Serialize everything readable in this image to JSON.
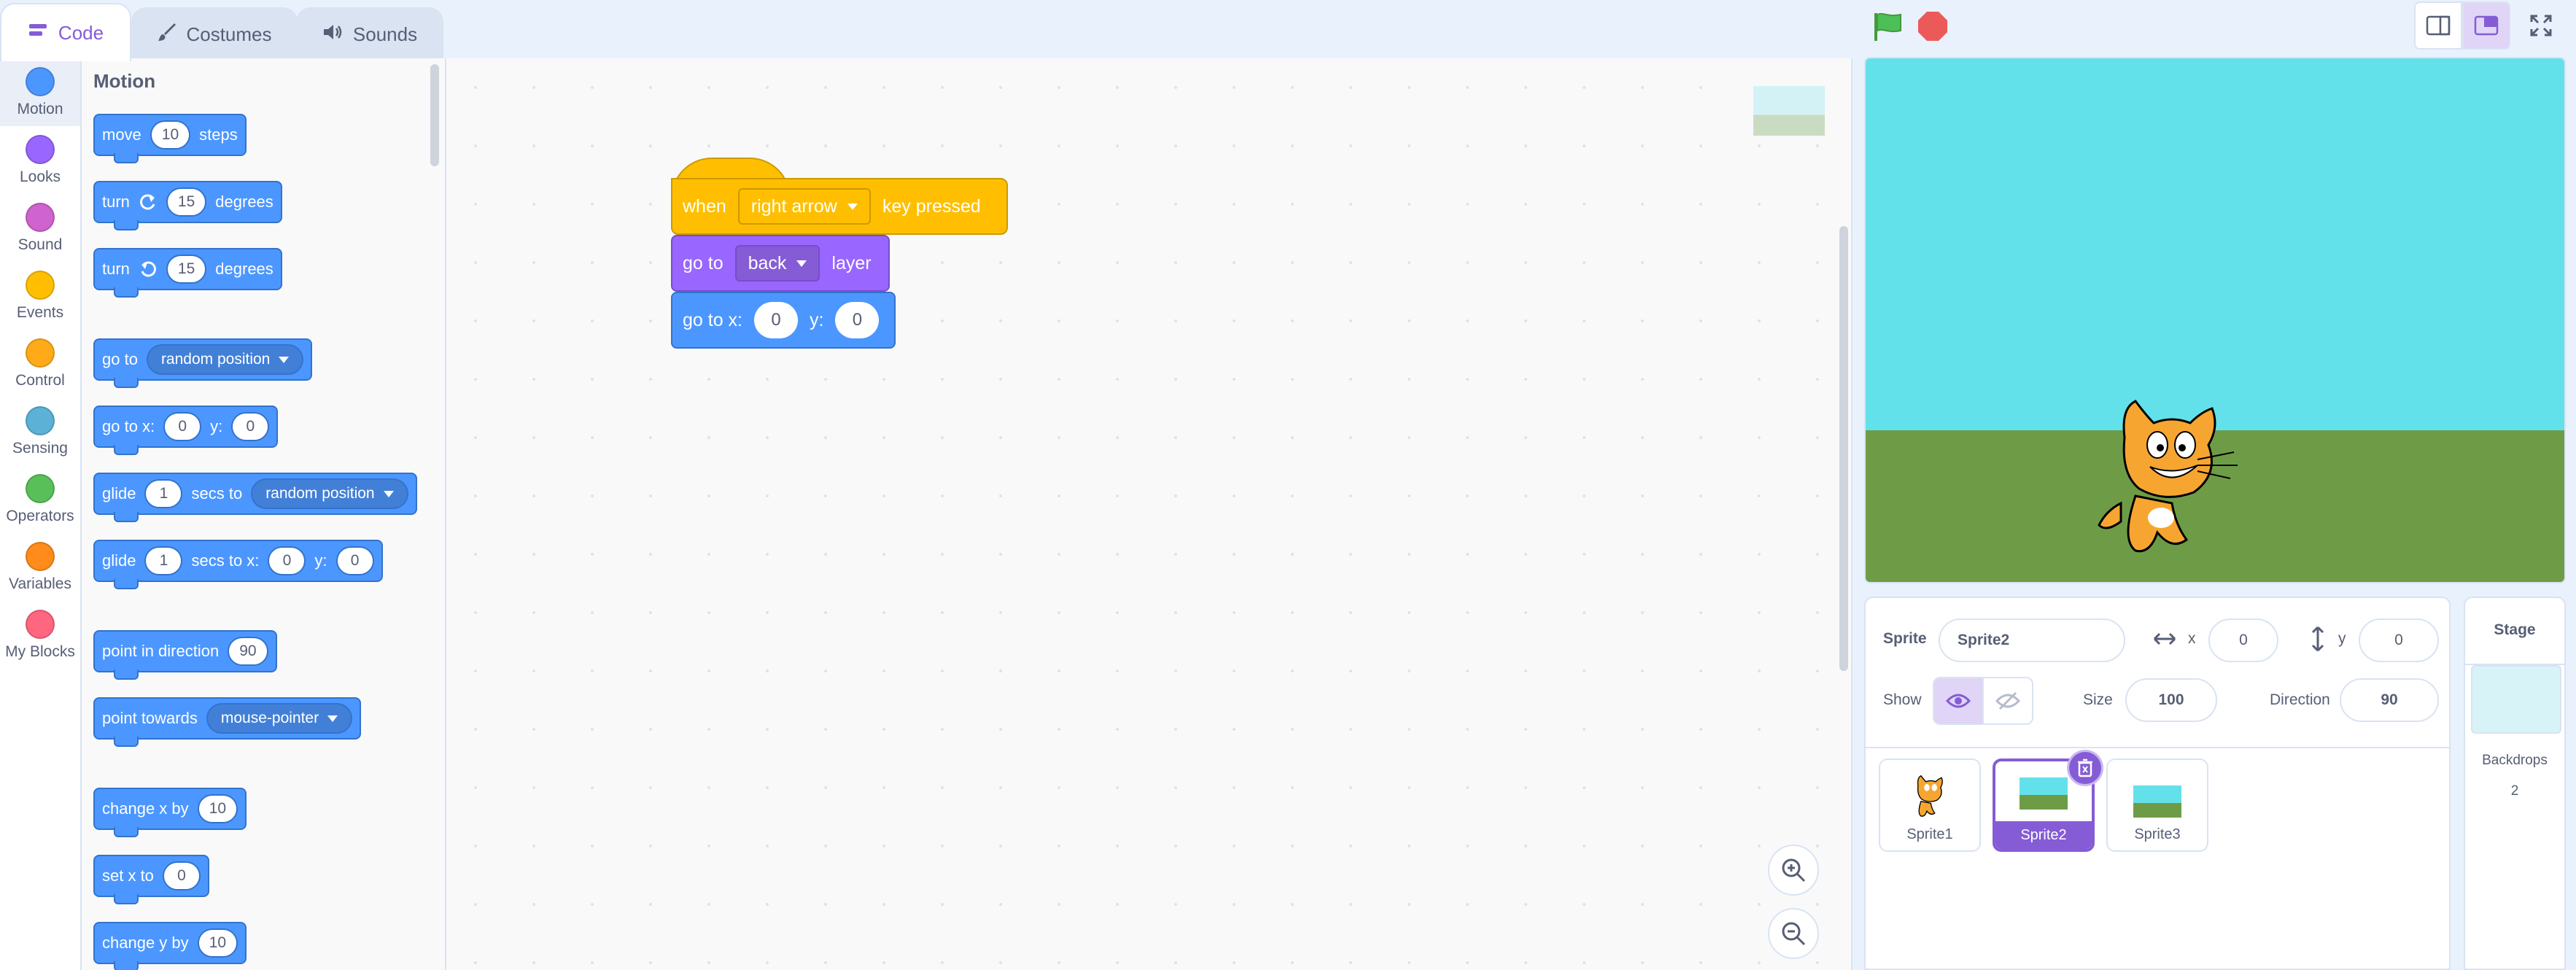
{
  "tabs": [
    {
      "label": "Code",
      "icon": "code-icon",
      "active": true
    },
    {
      "label": "Costumes",
      "icon": "brush-icon",
      "active": false
    },
    {
      "label": "Sounds",
      "icon": "speaker-icon",
      "active": false
    }
  ],
  "categories": [
    {
      "label": "Motion",
      "color": "#4c97ff"
    },
    {
      "label": "Looks",
      "color": "#9966ff"
    },
    {
      "label": "Sound",
      "color": "#cf63cf"
    },
    {
      "label": "Events",
      "color": "#ffbf00"
    },
    {
      "label": "Control",
      "color": "#ffab19"
    },
    {
      "label": "Sensing",
      "color": "#5cb1d6"
    },
    {
      "label": "Operators",
      "color": "#59c059"
    },
    {
      "label": "Variables",
      "color": "#ff8c1a"
    },
    {
      "label": "My Blocks",
      "color": "#ff6680"
    }
  ],
  "palette": {
    "title": "Motion",
    "move": {
      "a": "move",
      "v": "10",
      "b": "steps"
    },
    "turn_right": {
      "a": "turn",
      "v": "15",
      "b": "degrees"
    },
    "turn_left": {
      "a": "turn",
      "v": "15",
      "b": "degrees"
    },
    "goto": {
      "a": "go to",
      "opt": "random position"
    },
    "goto_xy": {
      "a": "go to x:",
      "x": "0",
      "b": "y:",
      "y": "0"
    },
    "glide_to": {
      "a": "glide",
      "v": "1",
      "b": "secs to",
      "opt": "random position"
    },
    "glide_xy": {
      "a": "glide",
      "v": "1",
      "b": "secs to x:",
      "x": "0",
      "c": "y:",
      "y": "0"
    },
    "point_dir": {
      "a": "point in direction",
      "v": "90"
    },
    "point_towards": {
      "a": "point towards",
      "opt": "mouse-pointer"
    },
    "change_x": {
      "a": "change x by",
      "v": "10"
    },
    "set_x": {
      "a": "set x to",
      "v": "0"
    },
    "change_y": {
      "a": "change y by",
      "v": "10"
    }
  },
  "script": {
    "hat": {
      "a": "when",
      "key": "right arrow",
      "b": "key pressed"
    },
    "layer": {
      "a": "go to",
      "opt": "back",
      "b": "layer"
    },
    "goto_xy": {
      "a": "go to x:",
      "x": "0",
      "b": "y:",
      "y": "0"
    }
  },
  "sprite_info": {
    "sprite_label": "Sprite",
    "sprite_name": "Sprite2",
    "x_label": "x",
    "x_value": "0",
    "y_label": "y",
    "y_value": "0",
    "show_label": "Show",
    "size_label": "Size",
    "size_value": "100",
    "direction_label": "Direction",
    "direction_value": "90"
  },
  "sprites": [
    {
      "name": "Sprite1",
      "selected": false
    },
    {
      "name": "Sprite2",
      "selected": true
    },
    {
      "name": "Sprite3",
      "selected": false
    }
  ],
  "stage_panel": {
    "title": "Stage",
    "backdrops_label": "Backdrops",
    "backdrops_count": "2"
  }
}
